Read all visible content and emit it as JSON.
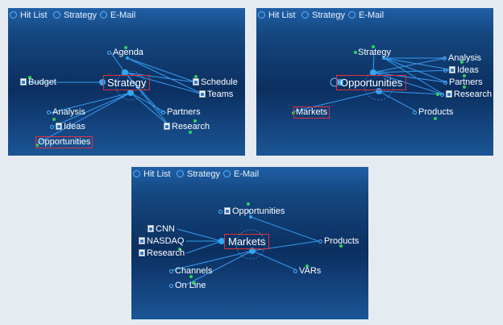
{
  "tabs": [
    "Hit List",
    "Strategy",
    "E-Mail"
  ],
  "colors": {
    "link": "#3aa6ff",
    "node": "#2fa8f2",
    "green": "#2fd35a",
    "highlight": "#e0303a"
  },
  "panel1": {
    "center": "Strategy",
    "nodes": [
      "Agenda",
      "Budget",
      "Schedule",
      "Teams",
      "Analysis",
      "Ideas",
      "Partners",
      "Research"
    ],
    "selected": "Opportunities"
  },
  "panel2": {
    "center": "Opportunities",
    "nodes": [
      "Strategy",
      "Analysis",
      "Ideas",
      "Partners",
      "Research",
      "Products"
    ],
    "selected": "Markets"
  },
  "panel3": {
    "center": "Markets",
    "nodes": [
      "Opportunities",
      "CNN",
      "NASDAQ",
      "Research",
      "Products",
      "Channels",
      "VARs",
      "On Line"
    ]
  }
}
